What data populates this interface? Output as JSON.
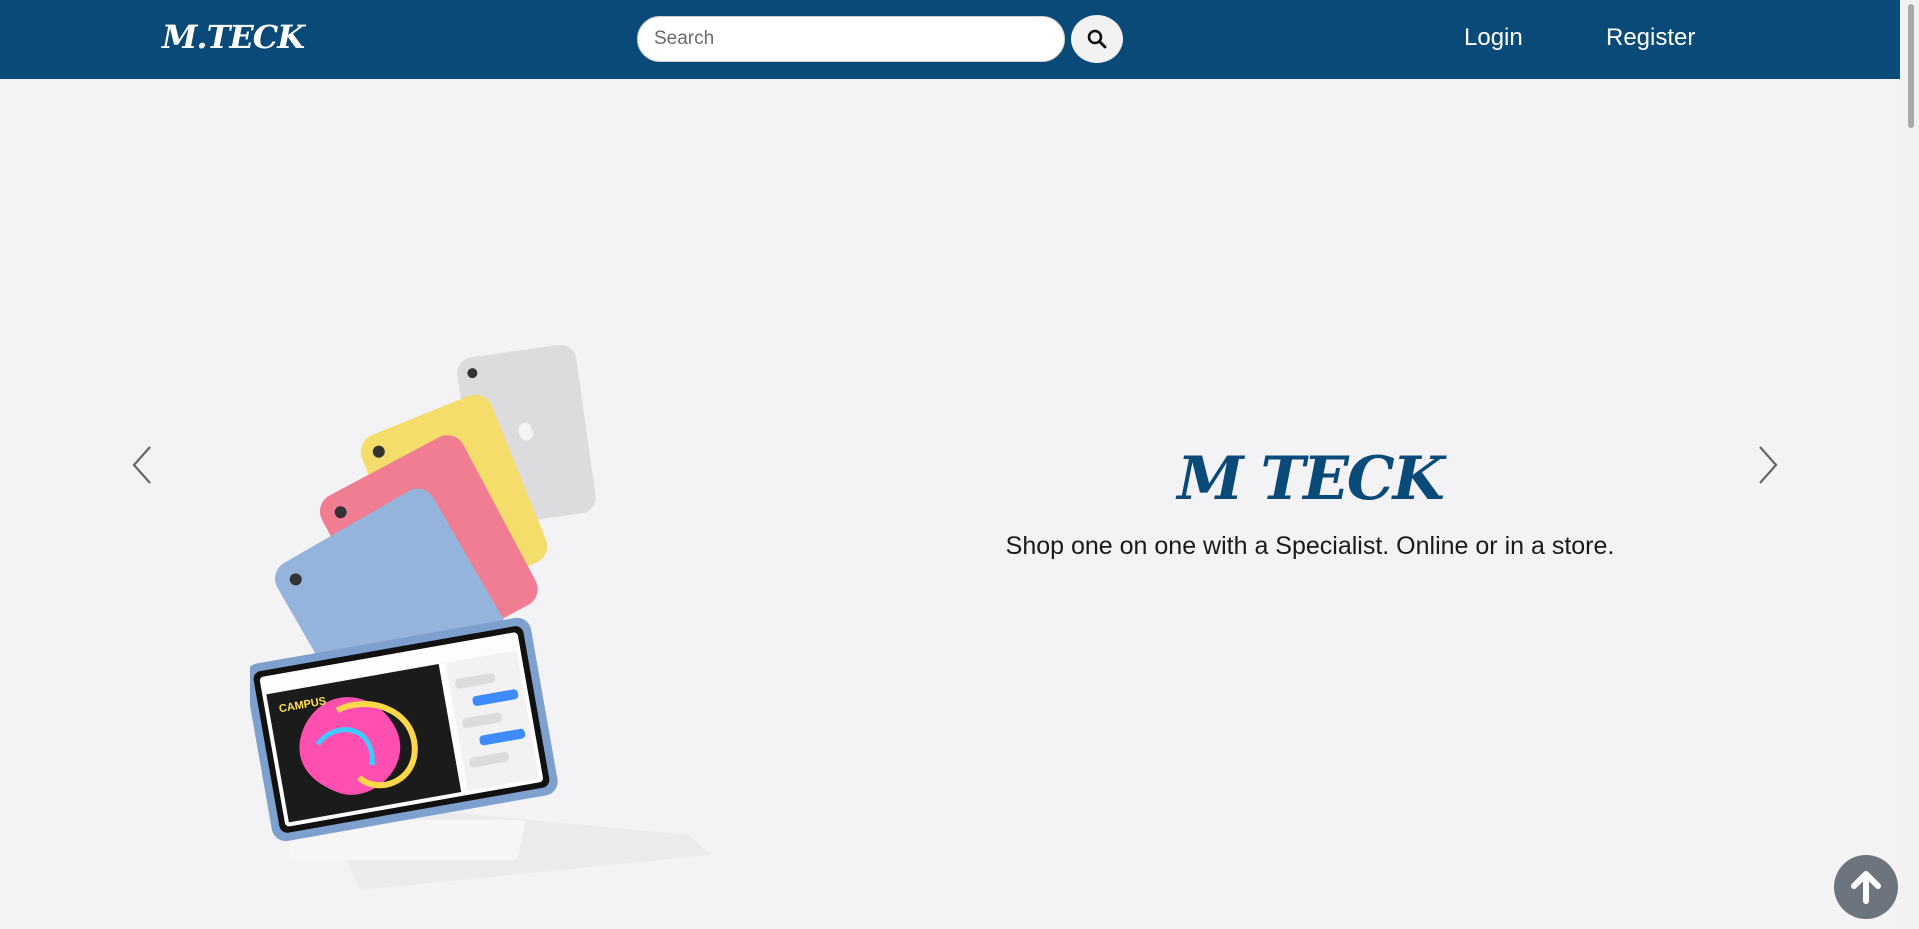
{
  "navbar": {
    "brand": "M.TECK",
    "search": {
      "placeholder": "Search",
      "value": "",
      "button_icon": "search-icon"
    },
    "links": {
      "login": "Login",
      "register": "Register"
    },
    "background_color": "#0a4a78"
  },
  "hero": {
    "title": "M TECK",
    "subtitle": "Shop one on one with a Specialist. Online or in a store.",
    "title_color": "#0a4a78",
    "image_icon": "ipad-lineup-illustration",
    "prev_icon": "chevron-left-icon",
    "next_icon": "chevron-right-icon"
  },
  "back_to_top": {
    "icon": "arrow-up-icon",
    "color": "#6c757d"
  }
}
